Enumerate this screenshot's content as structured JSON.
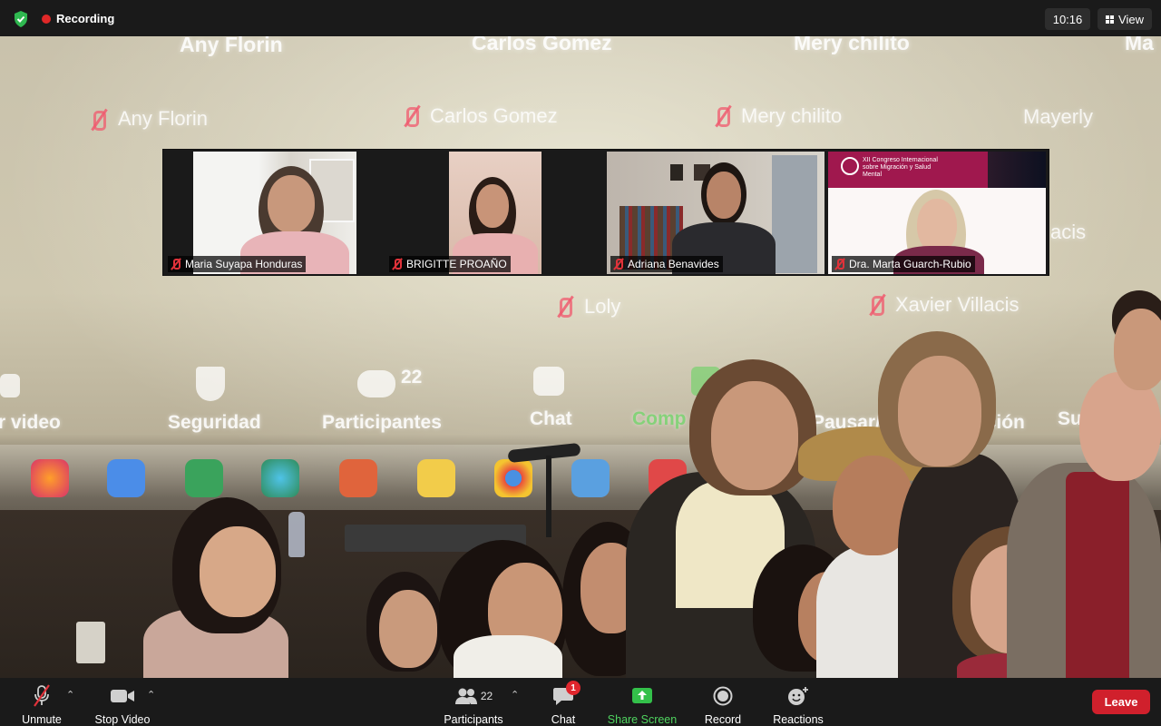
{
  "top_bar": {
    "recording_label": "Recording",
    "time": "10:16",
    "view_label": "View"
  },
  "projected_screen": {
    "names_top_row": [
      "Any Florin",
      "Carlos Gomez",
      "Mery chilito",
      "Ma"
    ],
    "names_second_row": [
      "Any Florin",
      "Carlos Gomez",
      "Mery chilito",
      "Mayerly"
    ],
    "names_lower": [
      "Loly",
      "Xavier Villacis",
      "acis"
    ],
    "toolbar_labels": [
      "r video",
      "Seguridad",
      "Participantes",
      "22",
      "Chat",
      "Comp",
      "Pausar/",
      "ación",
      "Su"
    ]
  },
  "participants": [
    {
      "name": "Maria Suyapa Honduras",
      "muted": true
    },
    {
      "name": "BRIGITTE PROAÑO",
      "muted": true
    },
    {
      "name": "Adriana Benavides",
      "muted": true
    },
    {
      "name": "Dra. Marta Guarch-Rubio",
      "muted": true
    }
  ],
  "slide_header": "XII Congreso Internacional sobre Migración y Salud Mental",
  "bottom_toolbar": {
    "unmute_label": "Unmute",
    "stop_video_label": "Stop Video",
    "participants_label": "Participants",
    "participants_count": "22",
    "chat_label": "Chat",
    "chat_badge": "1",
    "share_screen_label": "Share Screen",
    "record_label": "Record",
    "reactions_label": "Reactions",
    "leave_label": "Leave"
  },
  "colors": {
    "toolbar_bg": "#1a1a1a",
    "share_green": "#4fd35f",
    "leave_red": "#d0202c",
    "muted_red": "#e0323a",
    "recording_red": "#e02828"
  }
}
